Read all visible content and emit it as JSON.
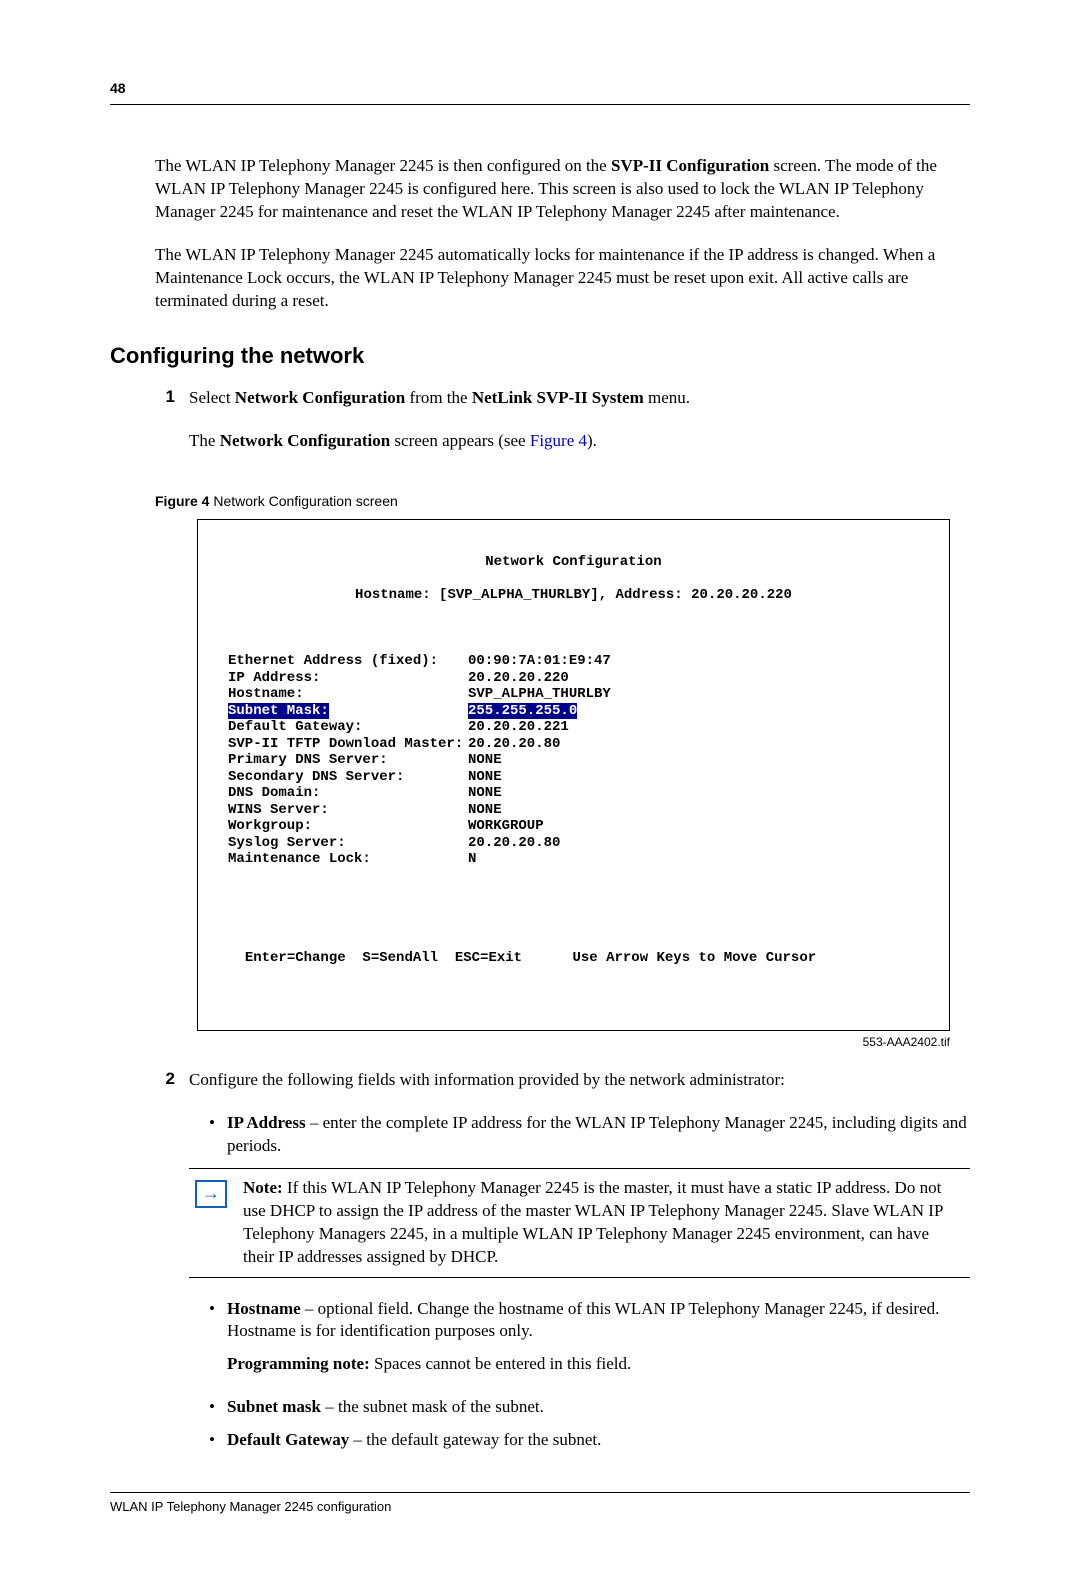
{
  "page_number": "48",
  "para1": "The WLAN IP Telephony Manager 2245 is then configured on the ",
  "para1_bold": "SVP-II Configuration",
  "para1_tail": " screen. The mode of the WLAN IP Telephony Manager 2245 is configured here. This screen is also used to lock the WLAN IP Telephony Manager 2245 for maintenance and reset the WLAN IP Telephony Manager 2245 after maintenance.",
  "para2": "The WLAN IP Telephony Manager 2245 automatically locks for maintenance if the IP address is changed. When a Maintenance Lock occurs, the WLAN IP Telephony Manager 2245 must be reset upon exit. All active calls are terminated during a reset.",
  "h2": "Configuring the network",
  "step1_a": "Select ",
  "step1_b": "Network Configuration",
  "step1_c": " from the ",
  "step1_d": "NetLink SVP-II System",
  "step1_e": " menu.",
  "step1_line2_a": "The ",
  "step1_line2_b": "Network Configuration",
  "step1_line2_c": " screen appears (see ",
  "step1_line2_link": "Figure 4",
  "step1_line2_d": ").",
  "fig_label_bold": "Figure 4",
  "fig_label_text": "   Network Configuration screen",
  "terminal": {
    "title": "Network Configuration",
    "subtitle_a": "Hostname: [",
    "subtitle_b": "SVP_ALPHA_THURLBY",
    "subtitle_c": "], Address: 20.20.20.220",
    "rows": [
      {
        "label": "Ethernet Address (fixed):",
        "value": "00:90:7A:01:E9:47"
      },
      {
        "label": "IP Address:",
        "value": "20.20.20.220"
      },
      {
        "label": "Hostname:",
        "value": "SVP_ALPHA_THURLBY"
      },
      {
        "label": "Subnet Mask:",
        "value": "255.255.255.0",
        "hi": true
      },
      {
        "label": "Default Gateway:",
        "value": "20.20.20.221"
      },
      {
        "label": "SVP-II TFTP Download Master:",
        "value": "20.20.20.80"
      },
      {
        "label": "Primary DNS Server:",
        "value": "NONE"
      },
      {
        "label": "Secondary DNS Server:",
        "value": "NONE"
      },
      {
        "label": "DNS Domain:",
        "value": "NONE"
      },
      {
        "label": "WINS Server:",
        "value": "NONE"
      },
      {
        "label": "Workgroup:",
        "value": "WORKGROUP"
      },
      {
        "label": "Syslog Server:",
        "value": "20.20.20.80"
      },
      {
        "label": "Maintenance Lock:",
        "value": "N"
      }
    ],
    "footer_left": "Enter=Change  S=SendAll  ESC=Exit",
    "footer_right": "Use Arrow Keys to Move Cursor"
  },
  "fig_id": "553-AAA2402.tif",
  "step2": "Configure the following fields with information provided by the network administrator:",
  "bullet_ip_bold": "IP Address",
  "bullet_ip_text": " – enter the complete IP address for the WLAN IP Telephony Manager 2245, including digits and periods.",
  "note_bold": "Note:",
  "note_text": " If this WLAN IP Telephony Manager 2245 is the master, it must have a static IP address. Do not use DHCP to assign the IP address of the master WLAN IP Telephony Manager 2245. Slave WLAN IP Telephony Managers 2245, in a multiple WLAN IP Telephony Manager 2245 environment, can have their IP addresses assigned by DHCP.",
  "bullet_host_bold": "Hostname",
  "bullet_host_text": " – optional field. Change the hostname of this WLAN IP Telephony Manager 2245, if desired. Hostname is for identification purposes only.",
  "prog_note_bold": "Programming note:",
  "prog_note_text": " Spaces cannot be entered in this field.",
  "bullet_mask_bold": "Subnet mask",
  "bullet_mask_text": " – the subnet mask of the subnet.",
  "bullet_gw_bold": "Default Gateway",
  "bullet_gw_text": " – the default gateway for the subnet.",
  "footer_text": "WLAN IP Telephony Manager 2245 configuration"
}
